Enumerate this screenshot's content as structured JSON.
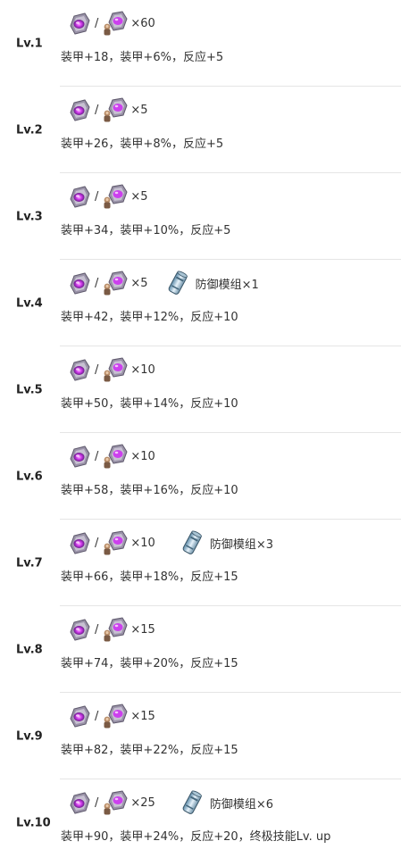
{
  "rows": [
    {
      "level": "Lv.1",
      "qty": "×60",
      "stats": "装甲+18，装甲+6%，反应+5",
      "extra": null
    },
    {
      "level": "Lv.2",
      "qty": "×5",
      "stats": "装甲+26，装甲+8%，反应+5",
      "extra": null
    },
    {
      "level": "Lv.3",
      "qty": "×5",
      "stats": "装甲+34，装甲+10%，反应+5",
      "extra": null
    },
    {
      "level": "Lv.4",
      "qty": "×5",
      "stats": "装甲+42，装甲+12%，反应+10",
      "extra": {
        "label": "防御模组×1",
        "icon": "defense-module-icon"
      }
    },
    {
      "level": "Lv.5",
      "qty": "×10",
      "stats": "装甲+50，装甲+14%，反应+10",
      "extra": null
    },
    {
      "level": "Lv.6",
      "qty": "×10",
      "stats": "装甲+58，装甲+16%，反应+10",
      "extra": null
    },
    {
      "level": "Lv.7",
      "qty": "×10",
      "stats": "装甲+66，装甲+18%，反应+15",
      "extra": {
        "label": "防御模组×3",
        "icon": "defense-module-icon"
      }
    },
    {
      "level": "Lv.8",
      "qty": "×15",
      "stats": "装甲+74，装甲+20%，反应+15",
      "extra": null
    },
    {
      "level": "Lv.9",
      "qty": "×15",
      "stats": "装甲+82，装甲+22%，反应+15",
      "extra": null
    },
    {
      "level": "Lv.10",
      "qty": "×25",
      "stats": "装甲+90，装甲+24%，反应+20，终极技能Lv. up",
      "extra": {
        "label": "防御模组×6",
        "icon": "defense-module-icon"
      }
    }
  ],
  "separator": "/",
  "icons": {
    "material_a": "purple-core-icon",
    "material_b": "purple-core-with-figure-icon",
    "extra": "defense-module-icon"
  },
  "colors": {
    "core": "#c04ee0",
    "divider": "#e5e5e5",
    "text": "#333333"
  }
}
